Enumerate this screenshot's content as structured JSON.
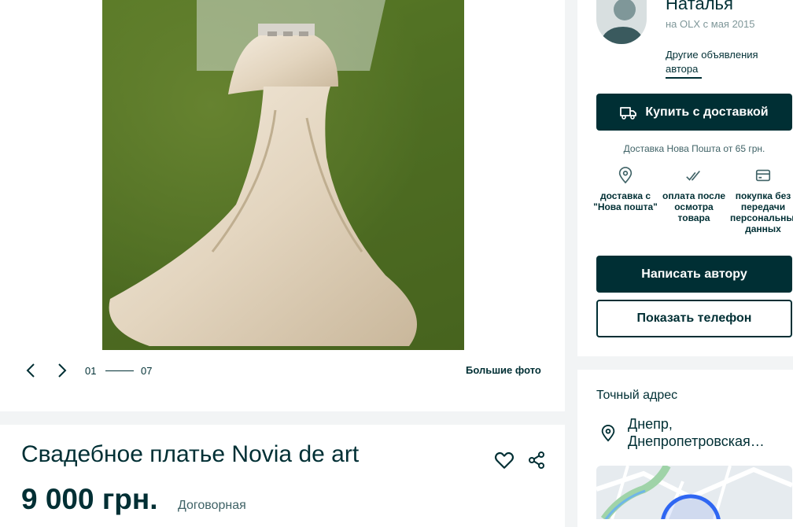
{
  "gallery": {
    "current": "01",
    "total": "07",
    "big_photos_label": "Большие фото"
  },
  "ad": {
    "title": "Свадебное платье Novia de art",
    "price": "9 000 грн.",
    "price_note": "Договорная"
  },
  "seller": {
    "name": "Наталья",
    "since": "на OLX с мая 2015",
    "other_ads_label": "Другие объявления автора"
  },
  "delivery": {
    "buy_label": "Купить с доставкой",
    "note": "Доставка Нова Пошта от 65 грн.",
    "features": [
      {
        "icon": "location-pin-icon",
        "label": "доставка с \"Нова пошта\""
      },
      {
        "icon": "double-check-icon",
        "label": "оплата после осмотра товара"
      },
      {
        "icon": "card-icon",
        "label": "покупка без передачи персональных данных"
      }
    ]
  },
  "contact": {
    "write_label": "Написать автору",
    "phone_label": "Показать телефон"
  },
  "address": {
    "heading": "Точный адрес",
    "city": "Днепр,",
    "region": "Днепропетровская…"
  },
  "colors": {
    "primary": "#002f34",
    "background": "#f2f4f5",
    "muted": "#7f9799"
  }
}
